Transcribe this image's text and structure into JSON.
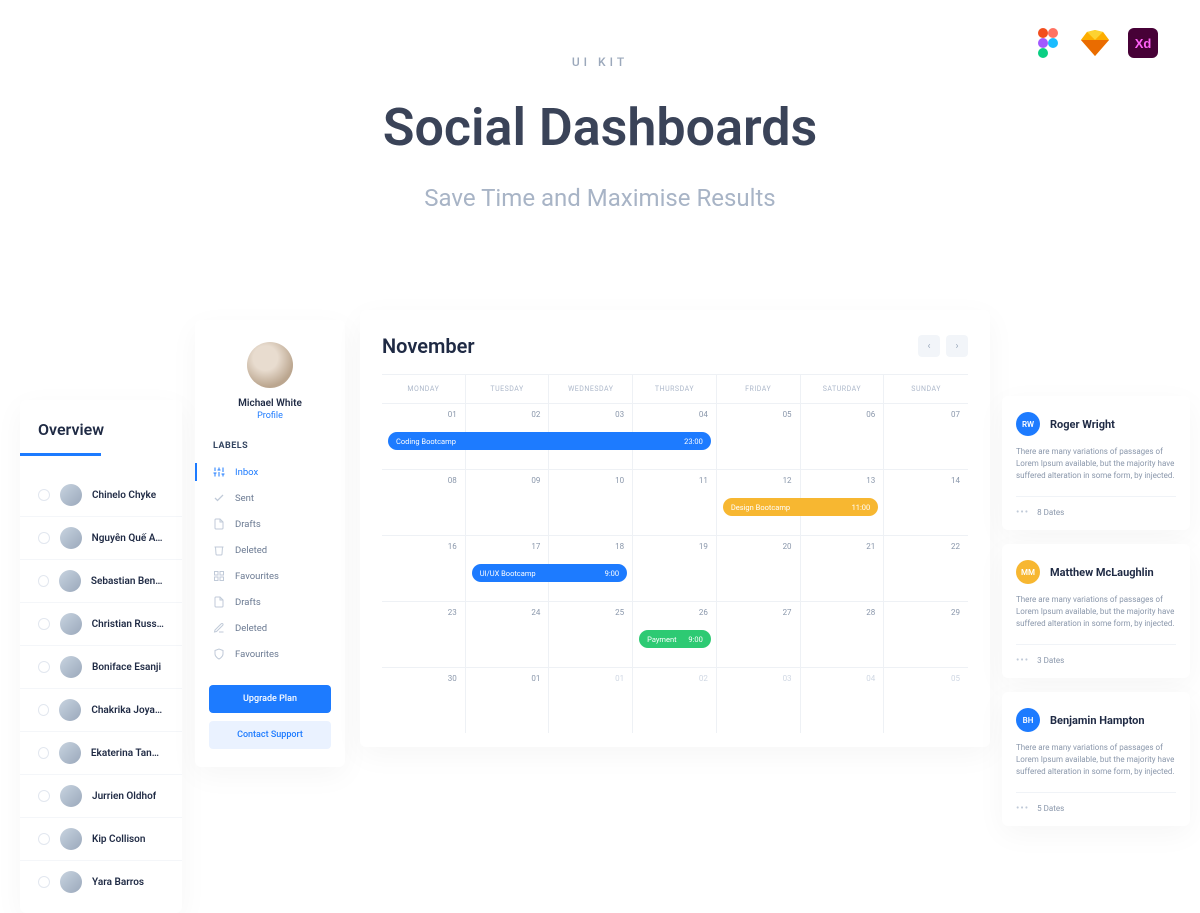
{
  "hero": {
    "kicker": "UI KIT",
    "title": "Social Dashboards",
    "subtitle": "Save Time and Maximise Results"
  },
  "tools": [
    "figma",
    "sketch",
    "xd"
  ],
  "overview": {
    "title": "Overview",
    "people": [
      {
        "name": "Chinelo Chyke"
      },
      {
        "name": "Nguyễn Quế Anh"
      },
      {
        "name": "Sebastian Bennett"
      },
      {
        "name": "Christian Russell"
      },
      {
        "name": "Boniface Esanji"
      },
      {
        "name": "Chakrika Joyanto"
      },
      {
        "name": "Ekaterina Tankova"
      },
      {
        "name": "Jurrien Oldhof"
      },
      {
        "name": "Kip Collison"
      },
      {
        "name": "Yara Barros"
      }
    ]
  },
  "profile": {
    "name": "Michael White",
    "link": "Profile",
    "labels_header": "LABELS",
    "labels": [
      {
        "name": "Inbox",
        "active": true,
        "icon": "sliders"
      },
      {
        "name": "Sent",
        "icon": "check"
      },
      {
        "name": "Drafts",
        "icon": "file"
      },
      {
        "name": "Deleted",
        "icon": "trash"
      },
      {
        "name": "Favourites",
        "icon": "grid"
      },
      {
        "name": "Drafts",
        "icon": "file"
      },
      {
        "name": "Deleted",
        "icon": "pencil"
      },
      {
        "name": "Favourites",
        "icon": "shield"
      }
    ],
    "upgrade": "Upgrade Plan",
    "support": "Contact Support"
  },
  "calendar": {
    "month": "November",
    "days": [
      "MONDAY",
      "TUESDAY",
      "WEDNESDAY",
      "THURSDAY",
      "FRIDAY",
      "SATURDAY",
      "SUNDAY"
    ],
    "cells": [
      "01",
      "02",
      "03",
      "04",
      "05",
      "06",
      "07",
      "08",
      "09",
      "10",
      "11",
      "12",
      "13",
      "14",
      "16",
      "17",
      "18",
      "19",
      "20",
      "21",
      "22",
      "23",
      "24",
      "25",
      "26",
      "27",
      "28",
      "29",
      "30",
      "01",
      "01",
      "02",
      "03",
      "04",
      "05"
    ],
    "events": {
      "coding": {
        "title": "Coding Bootcamp",
        "time": "23:00"
      },
      "design": {
        "title": "Design Bootcamp",
        "time": "11:00"
      },
      "uiux": {
        "title": "UI/UX Bootcamp",
        "time": "9:00"
      },
      "payment": {
        "title": "Payment",
        "time": "9:00"
      }
    }
  },
  "feed": [
    {
      "initials": "RW",
      "color": "blue",
      "name": "Roger Wright",
      "body": "There are many variations of passages of Lorem Ipsum available, but the majority have suffered alteration in some form, by injected.",
      "meta": "8 Dates"
    },
    {
      "initials": "MM",
      "color": "yellow",
      "name": "Matthew McLaughlin",
      "body": "There are many variations of passages of Lorem Ipsum available, but the majority have suffered alteration in some form, by injected.",
      "meta": "3 Dates"
    },
    {
      "initials": "BH",
      "color": "blue",
      "name": "Benjamin Hampton",
      "body": "There are many variations of passages of Lorem Ipsum available, but the majority have suffered alteration in some form, by injected.",
      "meta": "5 Dates"
    }
  ]
}
